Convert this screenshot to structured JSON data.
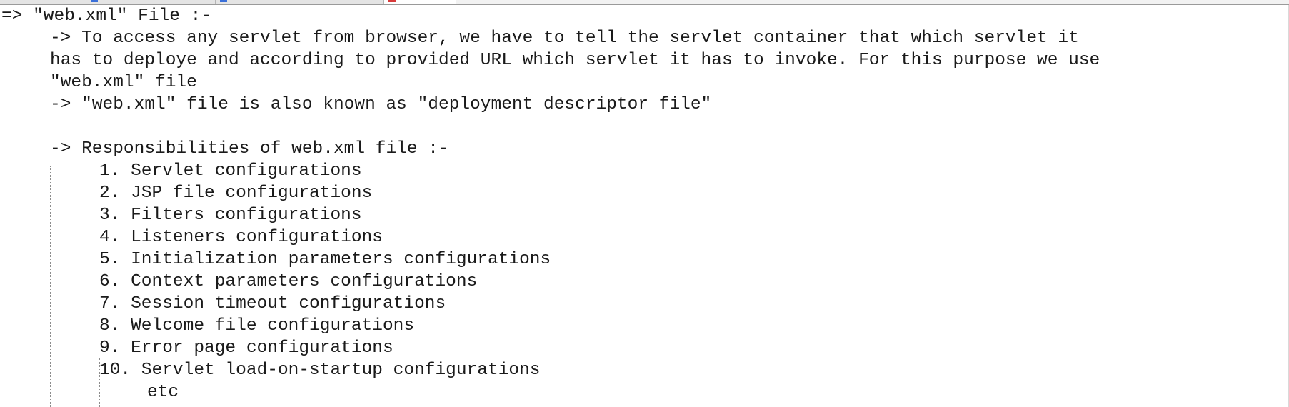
{
  "editor": {
    "lines": {
      "l1": "=> \"web.xml\" File :-",
      "l2": "-> To access any servlet from browser, we have to tell the servlet container that which servlet it",
      "l3": "has to deploye and according to provided URL which servlet it has to invoke. For this purpose we use",
      "l4": "\"web.xml\" file",
      "l5": "-> \"web.xml\" file is also known as \"deployment descriptor file\"",
      "l6": "",
      "l7": "-> Responsibilities of web.xml file :-",
      "l8": "1. Servlet configurations",
      "l9": "2. JSP file configurations",
      "l10": "3. Filters configurations",
      "l11": "4. Listeners configurations",
      "l12": "5. Initialization parameters configurations",
      "l13": "6. Context parameters configurations",
      "l14": "7. Session timeout configurations",
      "l15": "8. Welcome file configurations",
      "l16": "9. Error page configurations",
      "l17": "10. Servlet load-on-startup configurations",
      "l18": "etc"
    }
  },
  "colors": {
    "text": "#1a1a1a",
    "background": "#ffffff",
    "indent_guide": "#8c8c8c"
  }
}
